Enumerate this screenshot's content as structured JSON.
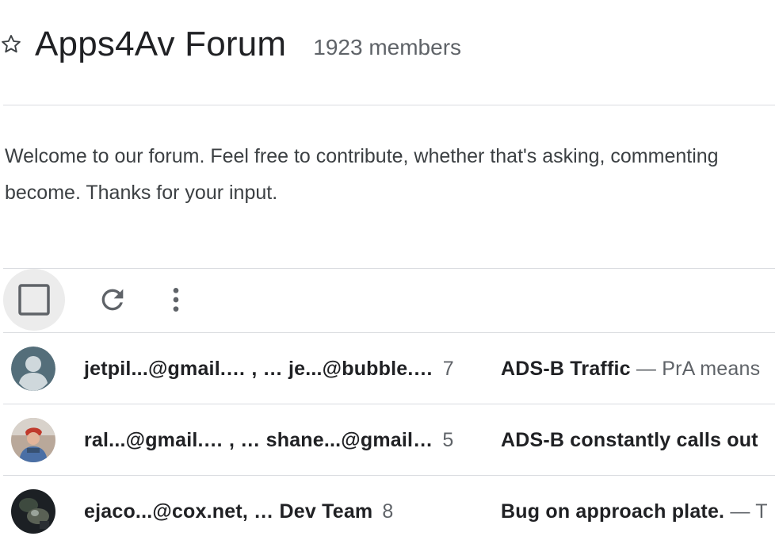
{
  "forum": {
    "title": "Apps4Av Forum",
    "members": "1923 members",
    "welcome_line1": "Welcome to our forum. Feel free to contribute, whether that's asking, commenting",
    "welcome_line2": "become. Thanks for your input."
  },
  "toolbar": {
    "select_all_icon": "checkbox-icon",
    "refresh_icon": "refresh-icon",
    "more_icon": "more-vert-icon"
  },
  "threads": [
    {
      "participants": "jetpil...@gmail.… , … je...@bubble.…",
      "count": "7",
      "subject": "ADS-B Traffic",
      "snippet": " — PrA means",
      "avatar": "default-person"
    },
    {
      "participants": "ral...@gmail.… , … shane...@gmail…",
      "count": "5",
      "subject": "ADS-B constantly calls out",
      "snippet": "",
      "avatar": "photo-person-red-cap"
    },
    {
      "participants": "ejaco...@cox.net, … Dev Team",
      "count": "8",
      "subject": "Bug on approach plate.",
      "snippet": " — T",
      "avatar": "photo-dark"
    }
  ],
  "colors": {
    "divider": "#dadce0",
    "text_primary": "#202124",
    "text_secondary": "#5f6368",
    "default_avatar_bg": "#546e7a"
  }
}
